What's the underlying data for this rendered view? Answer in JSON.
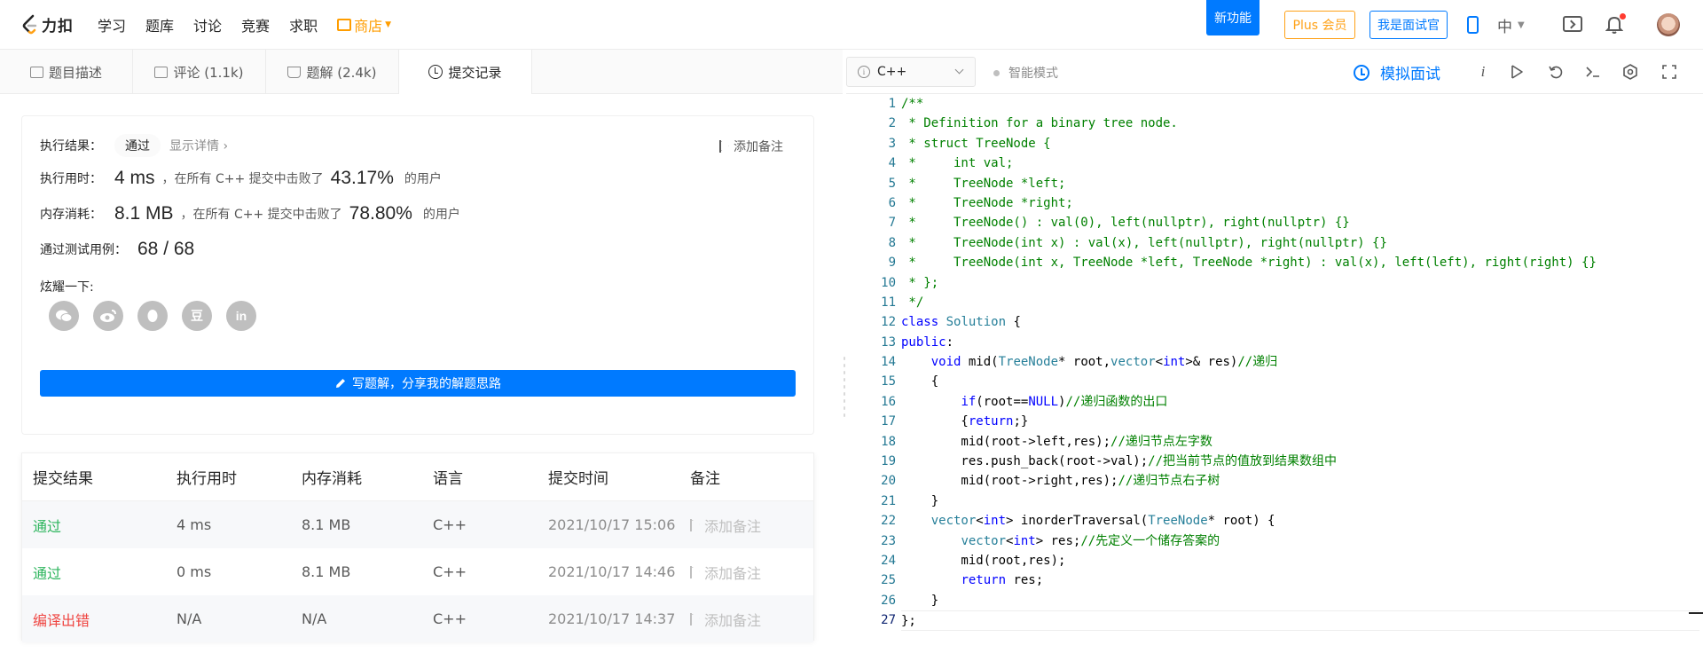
{
  "nav": {
    "logo_text": "力扣",
    "items": [
      "学习",
      "题库",
      "讨论",
      "竞赛",
      "求职"
    ],
    "shop_label": "商店",
    "new_feature": "新功能",
    "plus_label": "Plus 会员",
    "interviewer_label": "我是面试官",
    "lang_label": "中",
    "colors": {
      "accent": "#007aff",
      "shop": "#ff9d00",
      "plus": "#ffa116"
    }
  },
  "tabs": [
    {
      "label": "题目描述",
      "icon": "description-icon"
    },
    {
      "label": "评论 (1.1k)",
      "icon": "comment-icon"
    },
    {
      "label": "题解 (2.4k)",
      "icon": "flask-icon"
    },
    {
      "label": "提交记录",
      "icon": "clock-icon",
      "active": true
    }
  ],
  "result": {
    "result_label": "执行结果：",
    "status": "通过",
    "detail_link": "显示详情 ›",
    "add_note": "添加备注",
    "time_label": "执行用时：",
    "time_value": "4 ms",
    "time_text": "，在所有 C++ 提交中击败了",
    "time_pct": "43.17%",
    "users_text": "的用户",
    "mem_label": "内存消耗：",
    "mem_value": "8.1 MB",
    "mem_text": "，在所有 C++ 提交中击败了",
    "mem_pct": "78.80%",
    "cases_label": "通过测试用例：",
    "cases_value": "68 / 68",
    "share_label": "炫耀一下:",
    "share_icons": [
      "wechat-icon",
      "weibo-icon",
      "qq-icon",
      "douban-icon",
      "linkedin-icon"
    ],
    "douban_glyph": "豆",
    "linkedin_glyph": "in",
    "write_btn": "写题解，分享我的解题思路"
  },
  "table": {
    "headers": [
      "提交结果",
      "执行用时",
      "内存消耗",
      "语言",
      "提交时间",
      "备注"
    ],
    "rows": [
      {
        "status": "通过",
        "kind": "ok",
        "time": "4 ms",
        "memory": "8.1 MB",
        "lang": "C++",
        "submitted": "2021/10/17 15:06",
        "note": "添加备注"
      },
      {
        "status": "通过",
        "kind": "ok",
        "time": "0 ms",
        "memory": "8.1 MB",
        "lang": "C++",
        "submitted": "2021/10/17 14:46",
        "note": "添加备注"
      },
      {
        "status": "编译出错",
        "kind": "err",
        "time": "N/A",
        "memory": "N/A",
        "lang": "C++",
        "submitted": "2021/10/17 14:37",
        "note": "添加备注"
      }
    ],
    "colors": {
      "ok": "#2db55d",
      "err": "#ef4743"
    }
  },
  "editor": {
    "language": "C++",
    "smart_mode": "智能模式",
    "mock_interview": "模拟面试",
    "tool_icons": [
      "info-i-icon",
      "run-icon",
      "reset-icon",
      "terminal-icon",
      "settings-icon",
      "fullscreen-icon"
    ],
    "info_glyph": "i",
    "current_line": 27,
    "code": [
      "/**",
      " * Definition for a binary tree node.",
      " * struct TreeNode {",
      " *     int val;",
      " *     TreeNode *left;",
      " *     TreeNode *right;",
      " *     TreeNode() : val(0), left(nullptr), right(nullptr) {}",
      " *     TreeNode(int x) : val(x), left(nullptr), right(nullptr) {}",
      " *     TreeNode(int x, TreeNode *left, TreeNode *right) : val(x), left(left), right(right) {}",
      " * };",
      " */",
      "class Solution {",
      "public:",
      "    void mid(TreeNode* root,vector<int>& res)//递归",
      "    {",
      "        if(root==NULL)//递归函数的出口",
      "        {return;}",
      "        mid(root->left,res);//递归节点左字数",
      "        res.push_back(root->val);//把当前节点的值放到结果数组中",
      "        mid(root->right,res);//递归节点右子树",
      "    }",
      "    vector<int> inorderTraversal(TreeNode* root) {",
      "        vector<int> res;//先定义一个储存答案的",
      "        mid(root,res);",
      "        return res;",
      "    }",
      "};"
    ]
  }
}
